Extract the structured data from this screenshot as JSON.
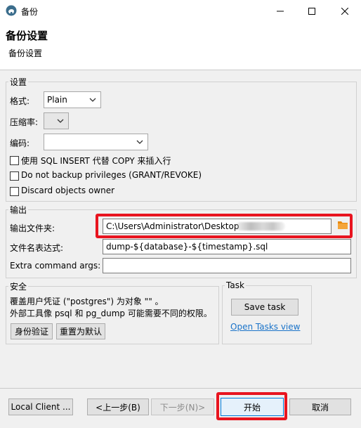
{
  "window": {
    "title": "备份"
  },
  "header": {
    "title": "备份设置",
    "subtitle": "备份设置"
  },
  "settings": {
    "legend": "设置",
    "format": {
      "label": "格式:",
      "value": "Plain"
    },
    "compression": {
      "label": "压缩率:",
      "value": ""
    },
    "encoding": {
      "label": "编码:",
      "value": ""
    },
    "checkboxes": [
      {
        "label": "使用 SQL INSERT 代替 COPY 来插入行",
        "checked": false
      },
      {
        "label": "Do not backup privileges (GRANT/REVOKE)",
        "checked": false
      },
      {
        "label": "Discard objects owner",
        "checked": false
      }
    ]
  },
  "output": {
    "legend": "输出",
    "folder": {
      "label": "输出文件夹:",
      "value": "C:\\Users\\Administrator\\Desktop"
    },
    "filename": {
      "label": "文件名表达式:",
      "value": "dump-${database}-${timestamp}.sql"
    },
    "extra": {
      "label": "Extra command args:",
      "value": ""
    }
  },
  "security": {
    "legend": "安全",
    "line1": "覆盖用户凭证 (\"postgres\") 为对象 \"\" 。",
    "line2": "外部工具像 psql 和 pg_dump 可能需要不同的权限。",
    "auth_button": "身份验证",
    "reset_button": "重置为默认"
  },
  "task": {
    "legend": "Task",
    "save_button": "Save task",
    "open_link": "Open Tasks view"
  },
  "footer": {
    "local_client": "Local Client ...",
    "prev": "<上一步(B)",
    "next": "下一步(N)>",
    "start": "开始",
    "cancel": "取消"
  },
  "colors": {
    "highlight": "#e8141f",
    "link": "#1a73c9",
    "folder_icon": "#e8890c"
  }
}
